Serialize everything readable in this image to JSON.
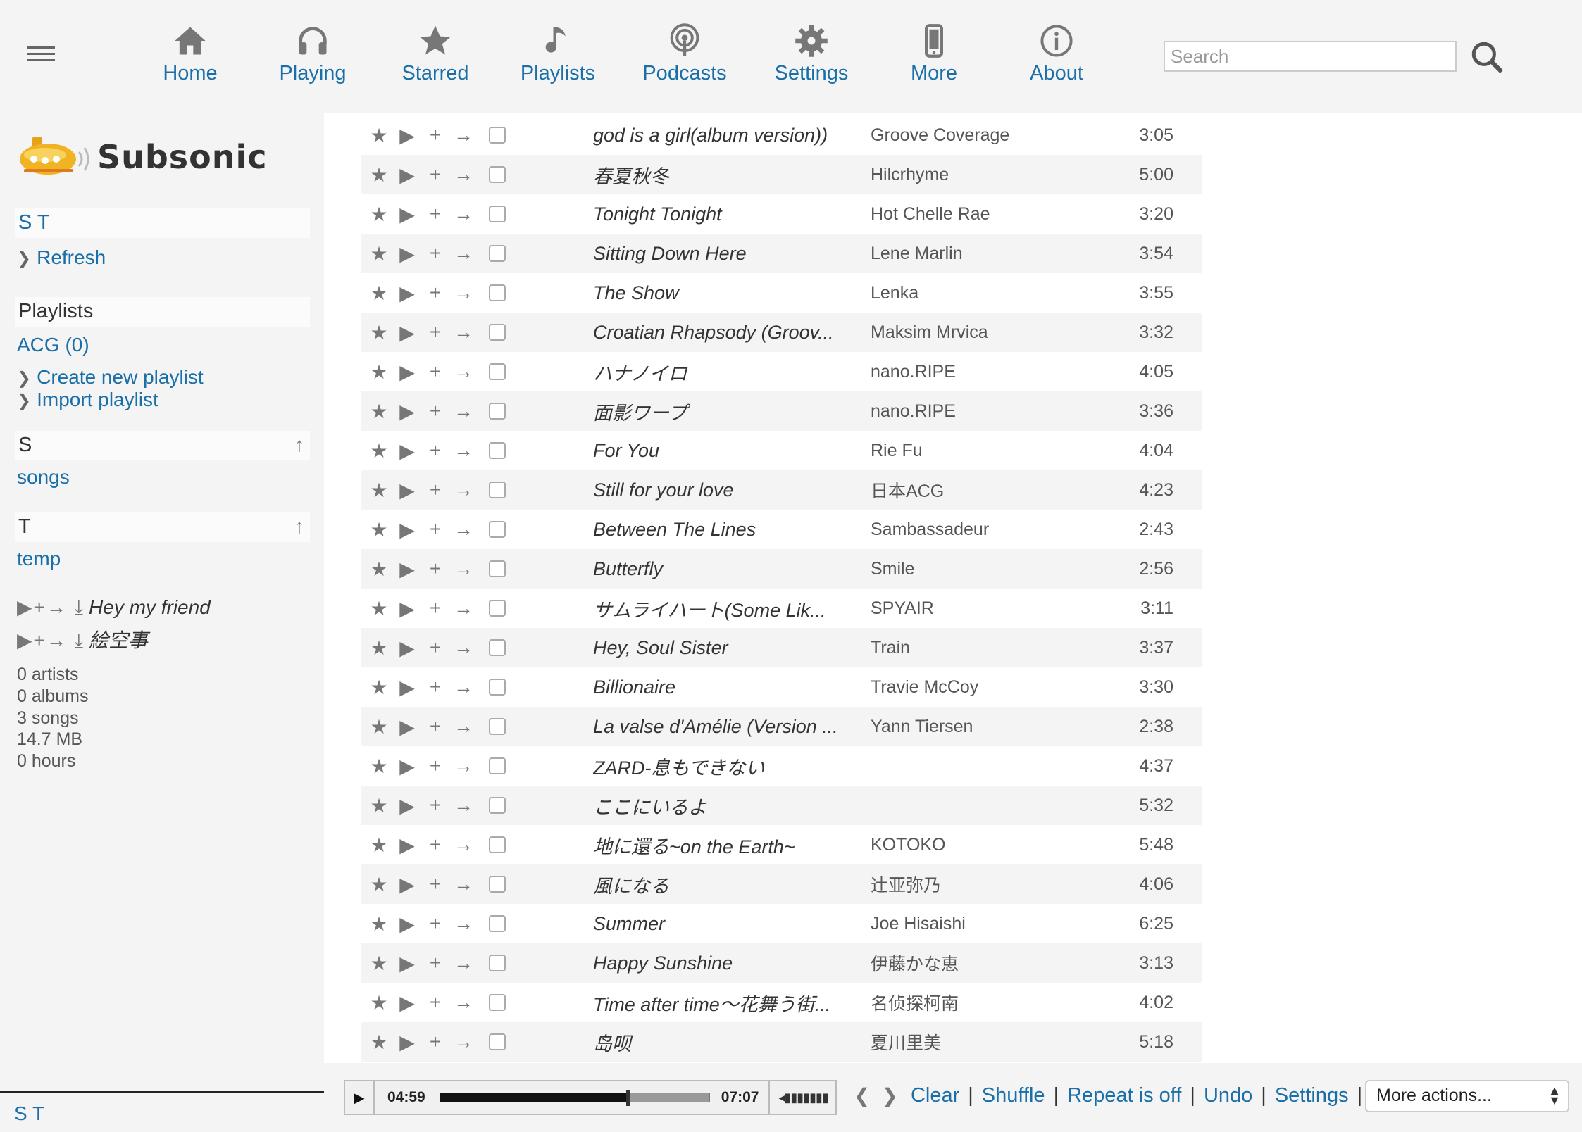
{
  "nav": {
    "items": [
      {
        "label": "Home",
        "icon": "home-icon"
      },
      {
        "label": "Playing",
        "icon": "headphones-icon"
      },
      {
        "label": "Starred",
        "icon": "star-icon"
      },
      {
        "label": "Playlists",
        "icon": "music-note-icon"
      },
      {
        "label": "Podcasts",
        "icon": "podcast-icon"
      },
      {
        "label": "Settings",
        "icon": "gear-icon"
      },
      {
        "label": "More",
        "icon": "phone-icon"
      },
      {
        "label": "About",
        "icon": "info-icon"
      }
    ],
    "search_placeholder": "Search"
  },
  "sidebar": {
    "logo_text": "Subsonic",
    "index_header": "S T",
    "refresh": "Refresh",
    "playlists_header": "Playlists",
    "playlist_item": "ACG (0)",
    "create_playlist": "Create new playlist",
    "import_playlist": "Import playlist",
    "section_s": "S",
    "section_s_item": "songs",
    "section_t": "T",
    "section_t_item": "temp",
    "mini_songs": [
      "Hey my friend",
      "絵空事"
    ],
    "stats": [
      "0 artists",
      "0 albums",
      "3 songs",
      "14.7 MB",
      "0 hours"
    ],
    "bottom_user": "S T"
  },
  "songs": [
    {
      "title": "god is a girl(album version))",
      "artist": "Groove Coverage",
      "duration": "3:05"
    },
    {
      "title": "春夏秋冬",
      "artist": "Hilcrhyme",
      "duration": "5:00"
    },
    {
      "title": "Tonight Tonight",
      "artist": "Hot Chelle Rae",
      "duration": "3:20"
    },
    {
      "title": "Sitting Down Here",
      "artist": "Lene Marlin",
      "duration": "3:54"
    },
    {
      "title": "The Show",
      "artist": "Lenka",
      "duration": "3:55"
    },
    {
      "title": "Croatian Rhapsody (Groov...",
      "artist": "Maksim Mrvica",
      "duration": "3:32"
    },
    {
      "title": "ハナノイロ",
      "artist": "nano.RIPE",
      "duration": "4:05"
    },
    {
      "title": "面影ワープ",
      "artist": "nano.RIPE",
      "duration": "3:36"
    },
    {
      "title": "For You",
      "artist": "Rie Fu",
      "duration": "4:04"
    },
    {
      "title": "Still for your love",
      "artist": "日本ACG",
      "duration": "4:23"
    },
    {
      "title": "Between The Lines",
      "artist": "Sambassadeur",
      "duration": "2:43"
    },
    {
      "title": "Butterfly",
      "artist": "Smile",
      "duration": "2:56"
    },
    {
      "title": "サムライハート(Some Lik...",
      "artist": "SPYAIR",
      "duration": "3:11"
    },
    {
      "title": "Hey, Soul Sister",
      "artist": "Train",
      "duration": "3:37"
    },
    {
      "title": "Billionaire",
      "artist": "Travie McCoy",
      "duration": "3:30"
    },
    {
      "title": "La valse d'Amélie (Version ...",
      "artist": "Yann Tiersen",
      "duration": "2:38"
    },
    {
      "title": "ZARD-息もできない",
      "artist": "",
      "duration": "4:37"
    },
    {
      "title": "ここにいるよ",
      "artist": "",
      "duration": "5:32"
    },
    {
      "title": "地に還る~on the Earth~",
      "artist": "KOTOKO",
      "duration": "5:48"
    },
    {
      "title": "風になる",
      "artist": "辻亚弥乃",
      "duration": "4:06"
    },
    {
      "title": "Summer",
      "artist": "Joe Hisaishi",
      "duration": "6:25"
    },
    {
      "title": "Happy Sunshine",
      "artist": "伊藤かな恵",
      "duration": "3:13"
    },
    {
      "title": "Time after time～花舞う街...",
      "artist": "名侦探柯南",
      "duration": "4:02"
    },
    {
      "title": "岛呗",
      "artist": "夏川里美",
      "duration": "5:18"
    }
  ],
  "player": {
    "current_time": "04:59",
    "total_time": "07:07",
    "progress_fraction": 0.7
  },
  "bottom": {
    "clear": "Clear",
    "shuffle": "Shuffle",
    "repeat": "Repeat is off",
    "undo": "Undo",
    "settings": "Settings",
    "more_actions": "More actions..."
  }
}
